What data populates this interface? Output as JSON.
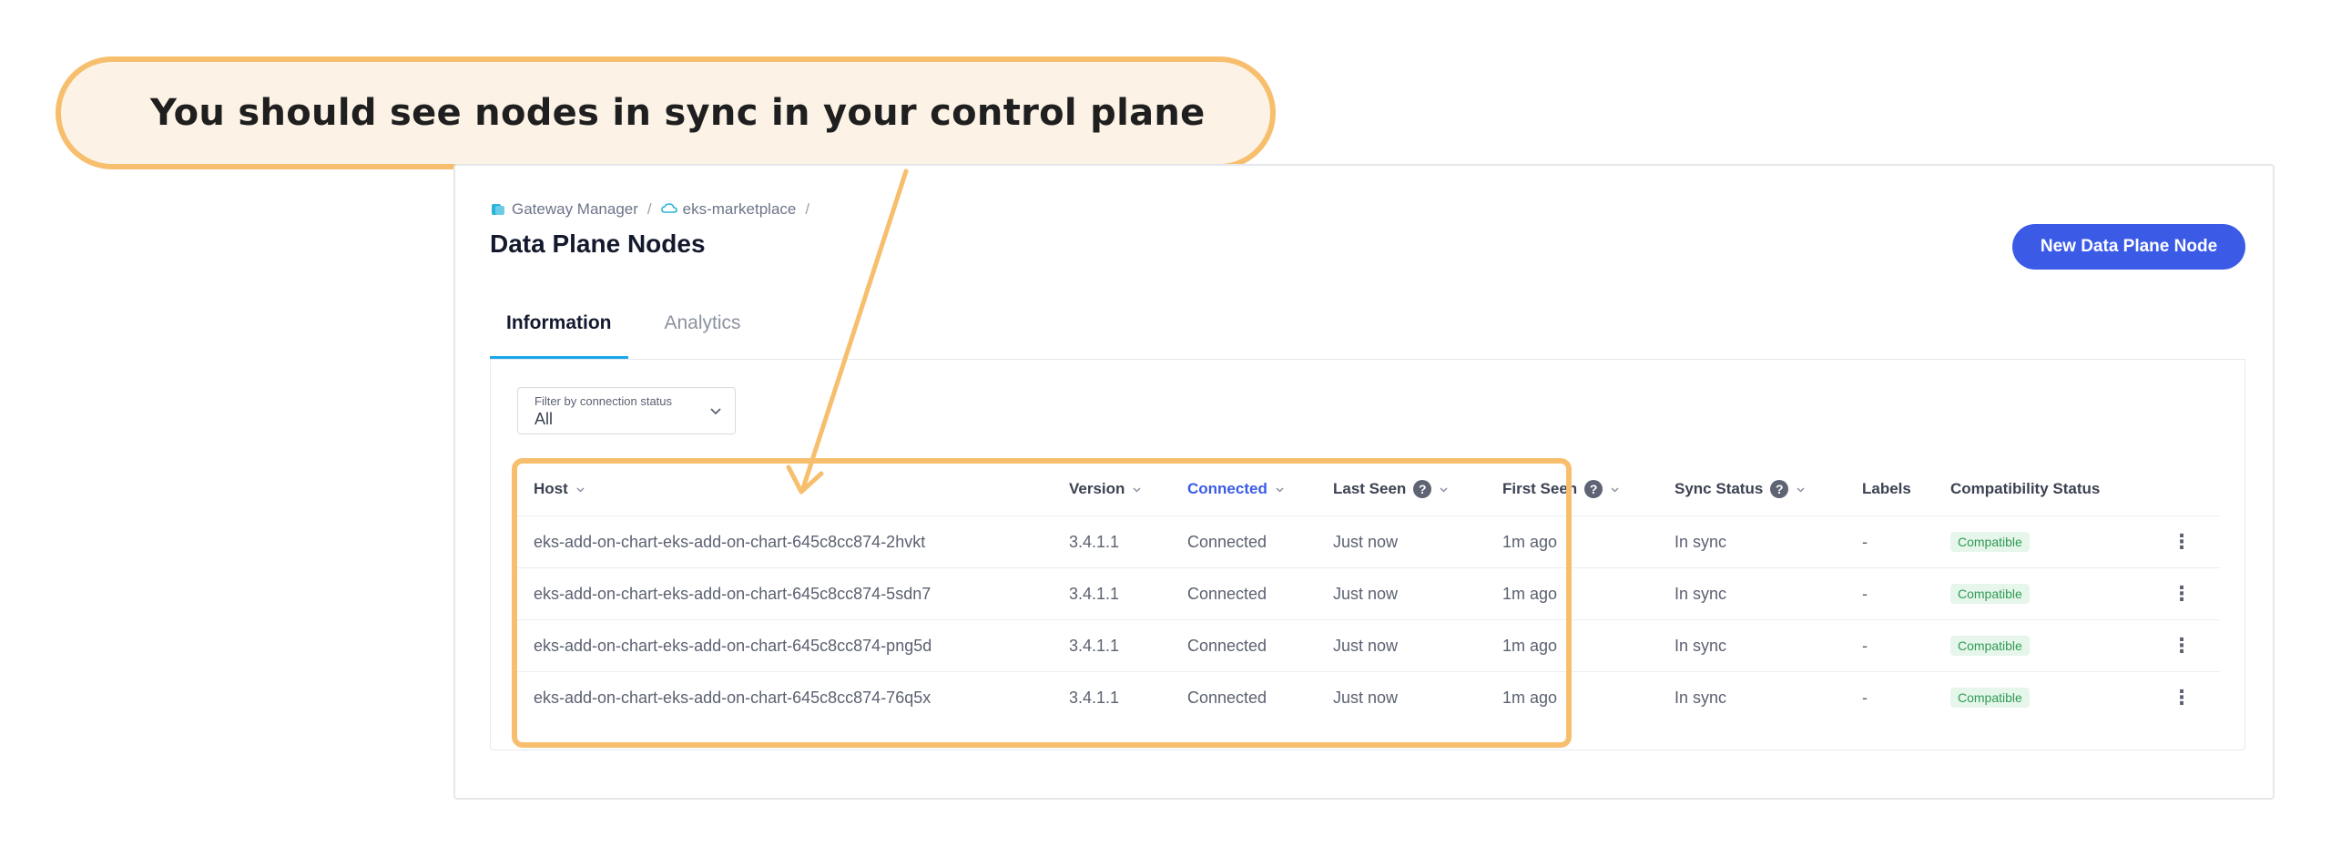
{
  "callout": {
    "text": "You should see nodes in sync in your control plane"
  },
  "colors": {
    "accent": "#3b5be7",
    "highlight": "#f7bf6d",
    "callout_bg": "#fcf3e6",
    "compatible_badge": "#2f9a55",
    "tab_underline": "#1aa7ec"
  },
  "breadcrumb": {
    "items": [
      {
        "label": "Gateway Manager",
        "icon": "gateway-manager-icon"
      },
      {
        "label": "eks-marketplace",
        "icon": "cloud-icon"
      }
    ],
    "separator": "/"
  },
  "page": {
    "title": "Data Plane Nodes"
  },
  "header": {
    "new_node_label": "New Data Plane Node"
  },
  "tabs": [
    {
      "label": "Information",
      "active": true
    },
    {
      "label": "Analytics",
      "active": false
    }
  ],
  "filter": {
    "label": "Filter by connection status",
    "value": "All"
  },
  "table": {
    "columns": {
      "host": "Host",
      "version": "Version",
      "connected": "Connected",
      "last_seen": "Last Seen",
      "first_seen": "First Seen",
      "sync_status": "Sync Status",
      "labels": "Labels",
      "compatibility": "Compatibility Status"
    },
    "help_glyph": "?",
    "actions_glyph": "⋮",
    "rows": [
      {
        "host": "eks-add-on-chart-eks-add-on-chart-645c8cc874-2hvkt",
        "version": "3.4.1.1",
        "connected": "Connected",
        "last_seen": "Just now",
        "first_seen": "1m ago",
        "sync_status": "In sync",
        "labels": "-",
        "compatibility": "Compatible"
      },
      {
        "host": "eks-add-on-chart-eks-add-on-chart-645c8cc874-5sdn7",
        "version": "3.4.1.1",
        "connected": "Connected",
        "last_seen": "Just now",
        "first_seen": "1m ago",
        "sync_status": "In sync",
        "labels": "-",
        "compatibility": "Compatible"
      },
      {
        "host": "eks-add-on-chart-eks-add-on-chart-645c8cc874-png5d",
        "version": "3.4.1.1",
        "connected": "Connected",
        "last_seen": "Just now",
        "first_seen": "1m ago",
        "sync_status": "In sync",
        "labels": "-",
        "compatibility": "Compatible"
      },
      {
        "host": "eks-add-on-chart-eks-add-on-chart-645c8cc874-76q5x",
        "version": "3.4.1.1",
        "connected": "Connected",
        "last_seen": "Just now",
        "first_seen": "1m ago",
        "sync_status": "In sync",
        "labels": "-",
        "compatibility": "Compatible"
      }
    ]
  }
}
